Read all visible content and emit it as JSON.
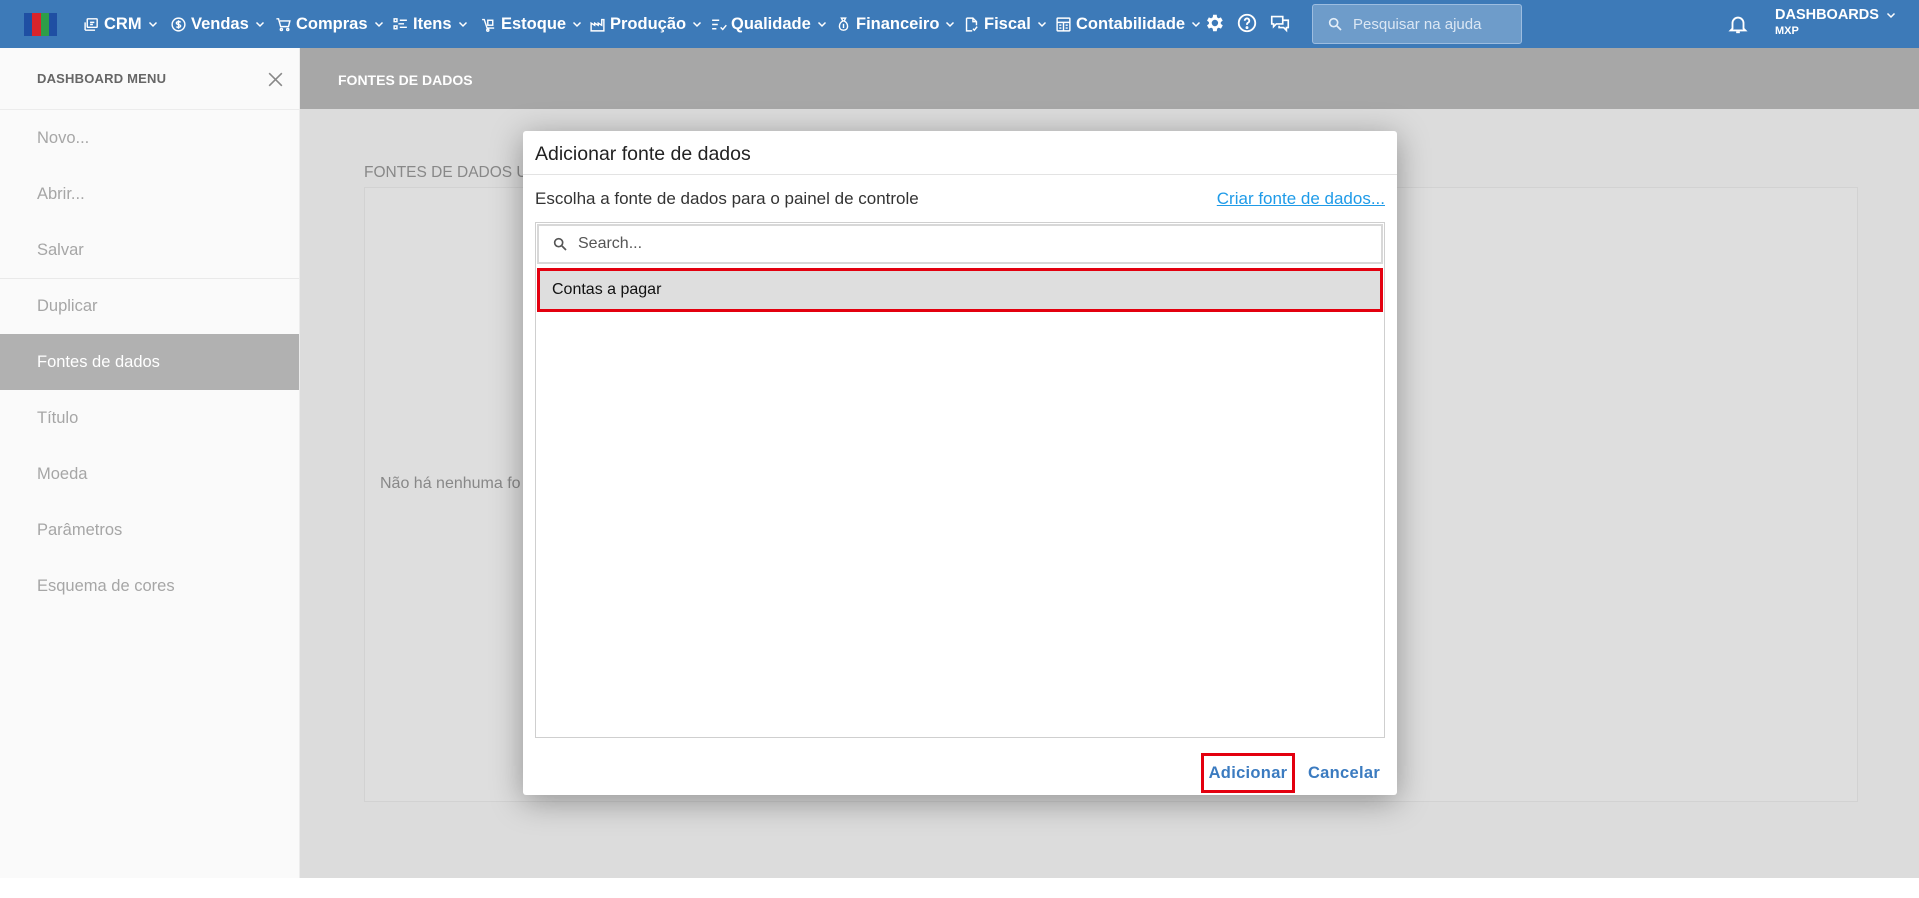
{
  "colors": {
    "topbar": "#3d7ab8",
    "accent_red": "#e3000f",
    "link_blue": "#1f9be8",
    "button_blue": "#3b7bc0",
    "sidebar_active": "#b1b1b1"
  },
  "topnav": {
    "logo_colors": [
      "#1f4fa3",
      "#d9242b",
      "#2e9e48",
      "#1f4fa3"
    ],
    "items": [
      {
        "label": "CRM",
        "icon": "crm-icon"
      },
      {
        "label": "Vendas",
        "icon": "dollar-circle-icon"
      },
      {
        "label": "Compras",
        "icon": "cart-icon"
      },
      {
        "label": "Itens",
        "icon": "items-icon"
      },
      {
        "label": "Estoque",
        "icon": "stock-icon"
      },
      {
        "label": "Produção",
        "icon": "factory-icon"
      },
      {
        "label": "Qualidade",
        "icon": "checklist-icon"
      },
      {
        "label": "Financeiro",
        "icon": "money-bag-icon"
      },
      {
        "label": "Fiscal",
        "icon": "document-check-icon"
      },
      {
        "label": "Contabilidade",
        "icon": "ledger-icon"
      }
    ],
    "tools": [
      "gear-icon",
      "help-icon",
      "chat-icon"
    ],
    "help_search_placeholder": "Pesquisar na ajuda",
    "user_name": "DASHBOARDS",
    "user_org": "MXP"
  },
  "sidebar": {
    "title": "DASHBOARD MENU",
    "items": [
      {
        "label": "Novo..."
      },
      {
        "label": "Abrir..."
      },
      {
        "label": "Salvar"
      },
      {
        "label": "Duplicar"
      },
      {
        "label": "Fontes de dados"
      },
      {
        "label": "Título"
      },
      {
        "label": "Moeda"
      },
      {
        "label": "Parâmetros"
      },
      {
        "label": "Esquema de cores"
      }
    ],
    "active_index": 4
  },
  "page": {
    "header_title": "FONTES DE DADOS",
    "section_label": "FONTES DE DADOS UT",
    "empty_text": "Não há nenhuma fo"
  },
  "dialog": {
    "title": "Adicionar fonte de dados",
    "subtitle": "Escolha a fonte de dados para o painel de controle",
    "create_link": "Criar fonte de dados...",
    "search_placeholder": "Search...",
    "sources": [
      "Contas a pagar"
    ],
    "add_button": "Adicionar",
    "cancel_button": "Cancelar"
  }
}
